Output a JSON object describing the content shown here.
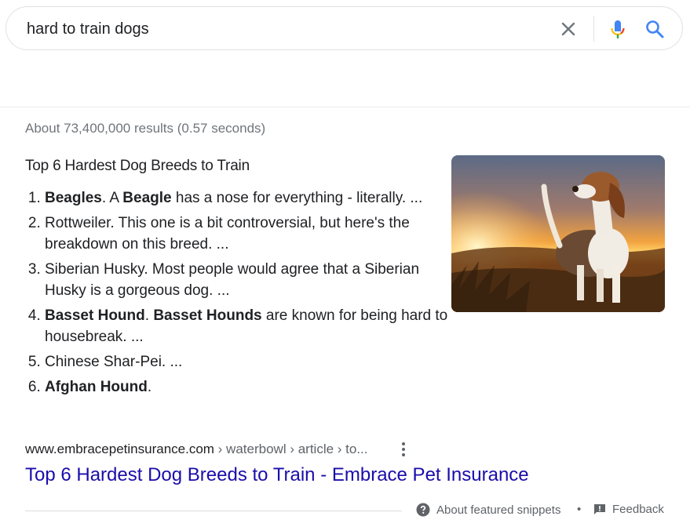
{
  "search": {
    "query": "hard to train dogs"
  },
  "results_stats": "About 73,400,000 results (0.57 seconds)",
  "featured_snippet": {
    "title": "Top 6 Hardest Dog Breeds to Train",
    "items": [
      {
        "bold1": "Beagles",
        "text1": ". A ",
        "bold2": "Beagle",
        "text2": " has a nose for everything - literally. ..."
      },
      {
        "bold1": "",
        "text1": "Rottweiler. This one is a bit controversial, but here's the breakdown on this breed. ...",
        "bold2": "",
        "text2": ""
      },
      {
        "bold1": "",
        "text1": "Siberian Husky. Most people would agree that a Siberian Husky is a gorgeous dog. ...",
        "bold2": "",
        "text2": ""
      },
      {
        "bold1": "Basset Hound",
        "text1": ". ",
        "bold2": "Basset Hounds",
        "text2": " are known for being hard to housebreak. ..."
      },
      {
        "bold1": "",
        "text1": "Chinese Shar-Pei. ...",
        "bold2": "",
        "text2": ""
      },
      {
        "bold1": "Afghan Hound",
        "text1": ".",
        "bold2": "",
        "text2": ""
      }
    ],
    "image": {
      "icon": "beagle-in-field-photo"
    }
  },
  "source": {
    "domain": "www.embracepetinsurance.com",
    "path": " › waterbowl › article › to..."
  },
  "result_title": "Top 6 Hardest Dog Breeds to Train - Embrace Pet Insurance",
  "footer": {
    "about_label": "About featured snippets",
    "separator": "•",
    "feedback_label": "Feedback"
  },
  "colors": {
    "link": "#1a0dab",
    "text": "#202124",
    "muted": "#5f6368",
    "search_icon": "#4285f4"
  }
}
